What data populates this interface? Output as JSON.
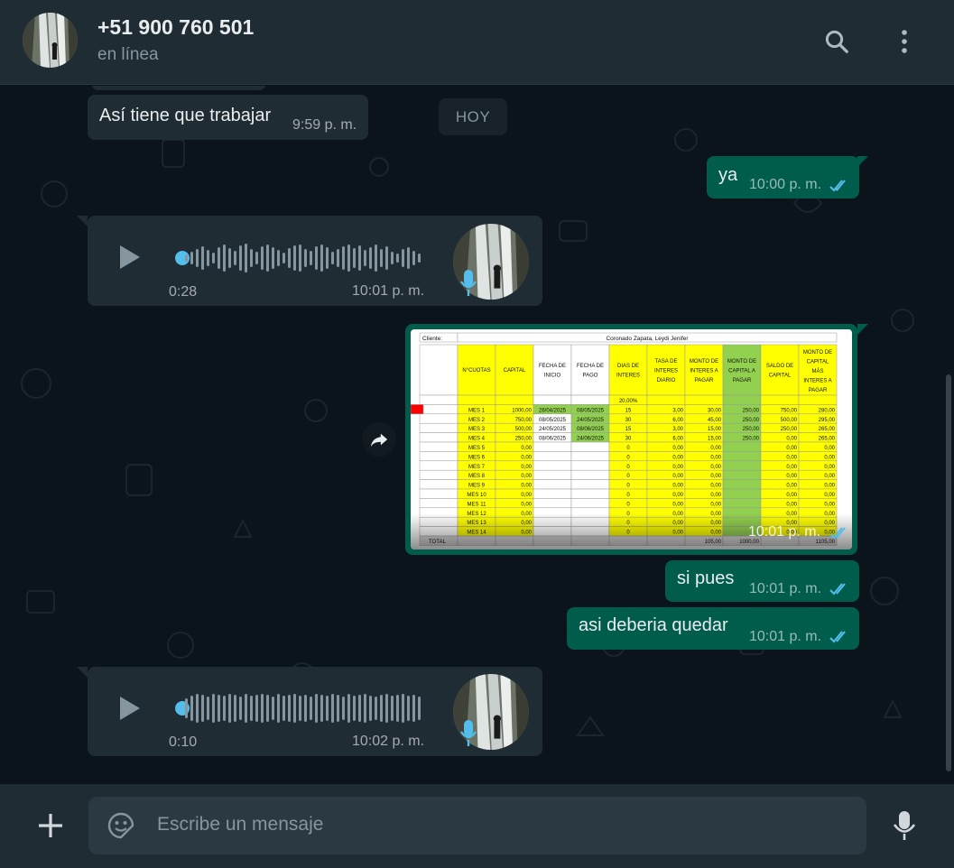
{
  "header": {
    "contact_name": "+51 900 760 501",
    "status": "en línea",
    "icons": [
      "search-icon",
      "more-vertical-icon"
    ]
  },
  "chat": {
    "date_divider": "HOY",
    "messages": [
      {
        "type": "text",
        "direction": "incoming",
        "text": "Así tiene que trabajar",
        "time": "9:59 p. m."
      },
      {
        "type": "text",
        "direction": "outgoing",
        "text": "ya",
        "time": "10:00 p. m.",
        "status": "read"
      },
      {
        "type": "audio",
        "direction": "incoming",
        "duration": "0:28",
        "time": "10:01 p. m.",
        "progress": 0
      },
      {
        "type": "image",
        "direction": "outgoing",
        "time": "10:01 p. m.",
        "status": "read"
      },
      {
        "type": "text",
        "direction": "outgoing",
        "text": "si pues",
        "time": "10:01 p. m.",
        "status": "read"
      },
      {
        "type": "text",
        "direction": "outgoing",
        "text": "asi deberia quedar",
        "time": "10:01 p. m.",
        "status": "read"
      },
      {
        "type": "audio",
        "direction": "incoming",
        "duration": "0:10",
        "time": "10:02 p. m.",
        "progress": 0
      }
    ]
  },
  "spreadsheet": {
    "client_label": "Cliente:",
    "client_name": "Coronado Zapata, Leydi Jenifer",
    "headers": [
      "N°CUOTAS",
      "CAPITAL",
      "FECHA DE INICIO",
      "FECHA DE PAGO",
      "DIAS DE INTERES",
      "TASA DE INTERES DIARIO",
      "MONTO DE INTERES A PAGAR",
      "MONTO DE CAPITAL A PAGAR",
      "SALDO DE CAPITAL",
      "MONTO DE CAPITAL MÁS INTERES A PAGAR"
    ],
    "rate": "20,00%",
    "rows": [
      [
        "MES 1",
        "1000,00",
        "26/04/2025",
        "08/05/2025",
        "15",
        "3,00",
        "30,00",
        "250,00",
        "750,00",
        "280,00"
      ],
      [
        "MES 2",
        "750,00",
        "08/05/2025",
        "24/05/2025",
        "30",
        "6,00",
        "45,00",
        "250,00",
        "500,00",
        "295,00"
      ],
      [
        "MES 3",
        "500,00",
        "24/05/2025",
        "08/06/2025",
        "15",
        "3,00",
        "15,00",
        "250,00",
        "250,00",
        "265,00"
      ],
      [
        "MES 4",
        "250,00",
        "08/06/2025",
        "24/06/2025",
        "30",
        "6,00",
        "15,00",
        "250,00",
        "0,00",
        "265,00"
      ],
      [
        "MES 5",
        "0,00",
        "",
        "",
        "0",
        "0,00",
        "0,00",
        "",
        "0,00",
        "0,00"
      ],
      [
        "MES 6",
        "0,00",
        "",
        "",
        "0",
        "0,00",
        "0,00",
        "",
        "0,00",
        "0,00"
      ],
      [
        "MES 7",
        "0,00",
        "",
        "",
        "0",
        "0,00",
        "0,00",
        "",
        "0,00",
        "0,00"
      ],
      [
        "MES 8",
        "0,00",
        "",
        "",
        "0",
        "0,00",
        "0,00",
        "",
        "0,00",
        "0,00"
      ],
      [
        "MES 9",
        "0,00",
        "",
        "",
        "0",
        "0,00",
        "0,00",
        "",
        "0,00",
        "0,00"
      ],
      [
        "MES 10",
        "0,00",
        "",
        "",
        "0",
        "0,00",
        "0,00",
        "",
        "0,00",
        "0,00"
      ],
      [
        "MES 11",
        "0,00",
        "",
        "",
        "0",
        "0,00",
        "0,00",
        "",
        "0,00",
        "0,00"
      ],
      [
        "MES 12",
        "0,00",
        "",
        "",
        "0",
        "0,00",
        "0,00",
        "",
        "0,00",
        "0,00"
      ],
      [
        "MES 13",
        "0,00",
        "",
        "",
        "0",
        "0,00",
        "0,00",
        "",
        "0,00",
        "0,00"
      ],
      [
        "MES 14",
        "0,00",
        "",
        "",
        "0",
        "0,00",
        "0,00",
        "",
        "0,00",
        "0,00"
      ]
    ],
    "total_label": "TOTAL",
    "total_interest": "105,00",
    "total_capital": "1000,00",
    "total_payment": "1105,00"
  },
  "composer": {
    "placeholder": "Escribe un mensaje"
  },
  "colors": {
    "header_bg": "#202c33",
    "chat_bg": "#0b141a",
    "incoming_bubble": "#202c33",
    "outgoing_bubble": "#005c4b",
    "read_ticks": "#53bdeb",
    "sheet_yellow": "#ffff00",
    "sheet_green": "#92d050"
  }
}
